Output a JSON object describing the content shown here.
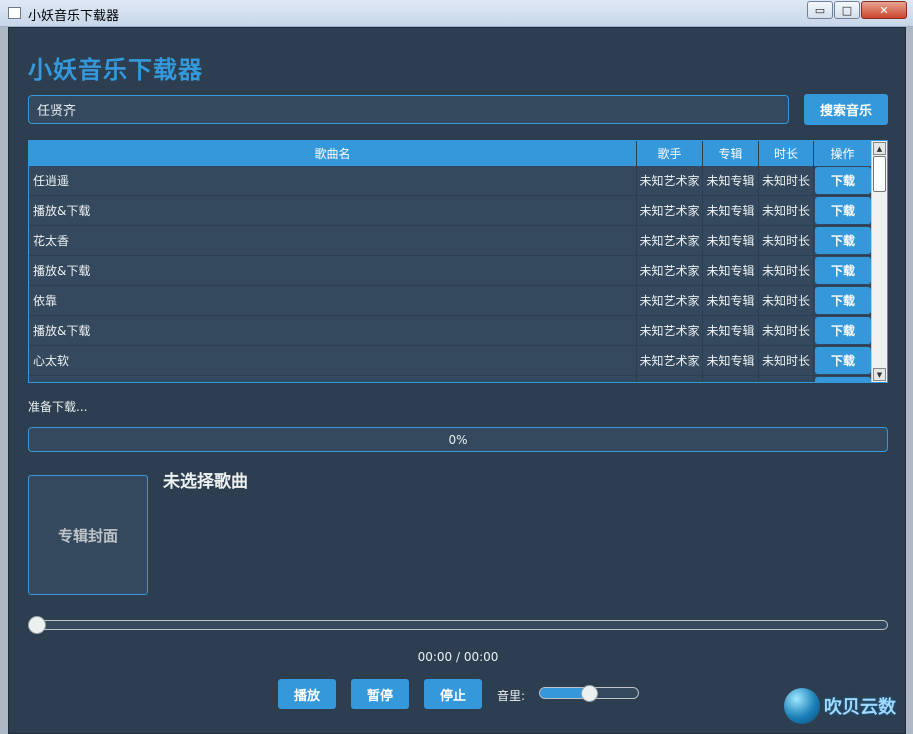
{
  "window": {
    "title": "小妖音乐下载器",
    "controls": {
      "minimize": "▭",
      "maximize": "□",
      "close": "✕"
    }
  },
  "app": {
    "title": "小妖音乐下载器"
  },
  "search": {
    "value": "任贤齐",
    "button_label": "搜索音乐"
  },
  "table": {
    "headers": {
      "name": "歌曲名",
      "artist": "歌手",
      "album": "专辑",
      "duration": "时长",
      "action": "操作"
    },
    "rows": [
      {
        "name": "任逍遥",
        "artist": "未知艺术家",
        "album": "未知专辑",
        "duration": "未知时长",
        "action": "下载"
      },
      {
        "name": "播放&下载",
        "artist": "未知艺术家",
        "album": "未知专辑",
        "duration": "未知时长",
        "action": "下载"
      },
      {
        "name": "花太香",
        "artist": "未知艺术家",
        "album": "未知专辑",
        "duration": "未知时长",
        "action": "下载"
      },
      {
        "name": "播放&下载",
        "artist": "未知艺术家",
        "album": "未知专辑",
        "duration": "未知时长",
        "action": "下载"
      },
      {
        "name": "依靠",
        "artist": "未知艺术家",
        "album": "未知专辑",
        "duration": "未知时长",
        "action": "下载"
      },
      {
        "name": "播放&下载",
        "artist": "未知艺术家",
        "album": "未知专辑",
        "duration": "未知时长",
        "action": "下载"
      },
      {
        "name": "心太软",
        "artist": "未知艺术家",
        "album": "未知专辑",
        "duration": "未知时长",
        "action": "下载"
      },
      {
        "name": "",
        "artist": "",
        "album": "",
        "duration": "",
        "action": ""
      }
    ]
  },
  "status": {
    "text": "准备下载..."
  },
  "progress": {
    "value": 0,
    "label": "0%"
  },
  "cover": {
    "label": "专辑封面"
  },
  "song": {
    "title": "未选择歌曲"
  },
  "player": {
    "seek_fraction": 0,
    "time": "00:00 / 00:00",
    "play_label": "播放",
    "pause_label": "暂停",
    "stop_label": "停止",
    "volume_label": "音里:",
    "volume_fraction": 0.5
  },
  "watermark": {
    "text": "吹贝云数"
  },
  "colors": {
    "accent": "#3498db",
    "background": "#2c3e50",
    "panel": "#34495e",
    "text": "#ecf0f1"
  }
}
